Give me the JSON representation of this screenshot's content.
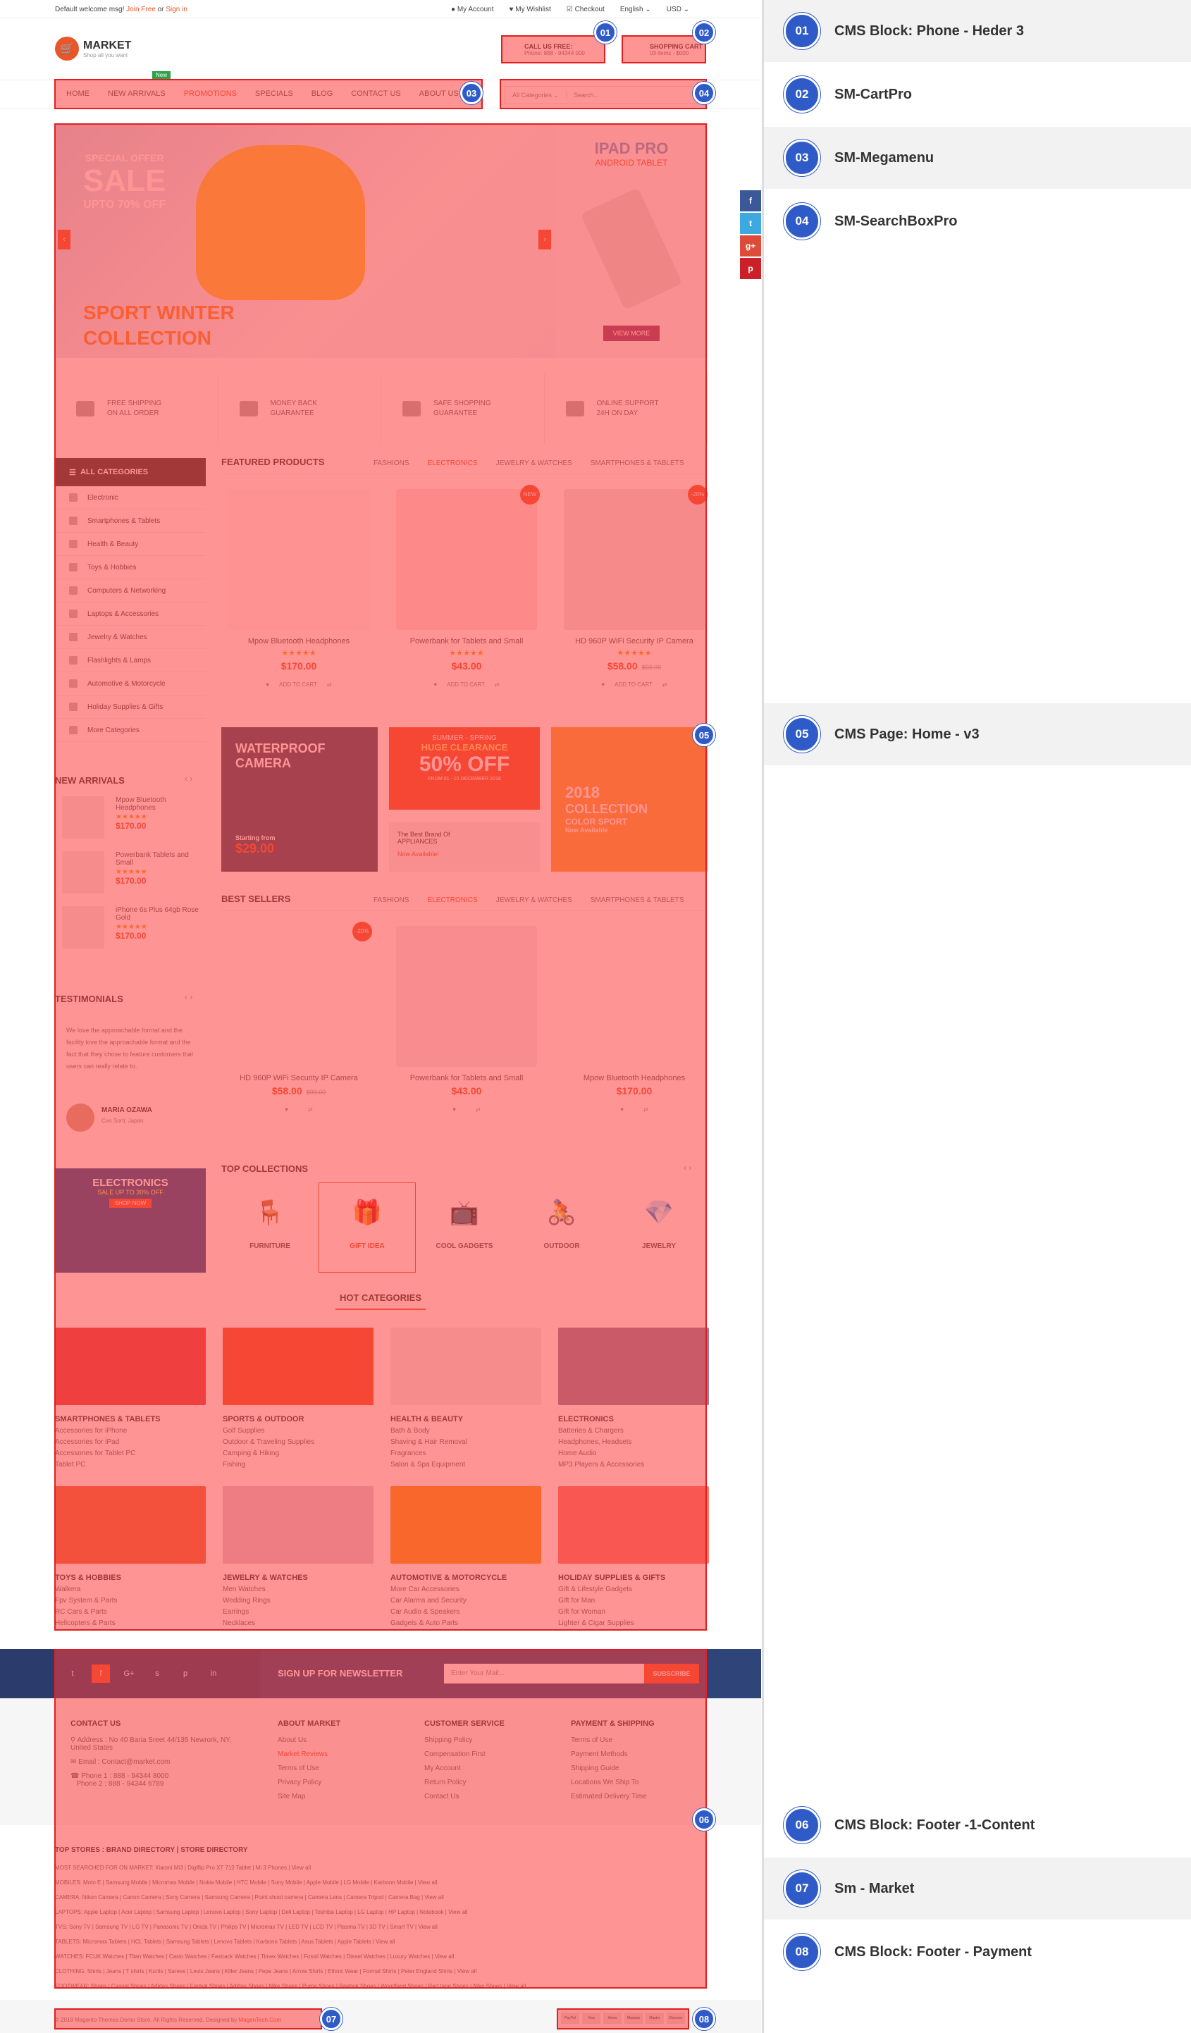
{
  "topbar": {
    "welcome": "Default welcome msg!",
    "join": "Join Free",
    "or": "or",
    "signin": "Sign in",
    "account": "My Account",
    "wishlist": "My Wishlist",
    "checkout": "Checkout",
    "language": "English",
    "currency": "USD"
  },
  "logo": {
    "name": "MARKET",
    "tagline": "Shop all you want"
  },
  "phone": {
    "title": "CALL US FREE:",
    "number": "Phone: 888 - 94344 000"
  },
  "cart": {
    "title": "SHOPPING CART",
    "items": "03 items - $000"
  },
  "nav": {
    "badge": "New",
    "items": [
      "HOME",
      "NEW ARRIVALS",
      "PROMOTIONS",
      "SPECIALS",
      "BLOG",
      "CONTACT US",
      "ABOUT US"
    ]
  },
  "search": {
    "category": "All Categories",
    "placeholder": "Search..."
  },
  "slider": {
    "special": "SPECIAL OFFER",
    "sale": "SALE",
    "upto": "UPTO 70% OFF",
    "coll1": "SPORT WINTER",
    "coll2": "COLLECTION",
    "side_title": "IPAD PRO",
    "side_sub": "ANDROID TABLET",
    "view_more": "VIEW MORE"
  },
  "services": [
    {
      "l1": "FREE SHIPPING",
      "l2": "ON ALL ORDER"
    },
    {
      "l1": "MONEY BACK",
      "l2": "GUARANTEE"
    },
    {
      "l1": "SAFE SHOPPING",
      "l2": "GUARANTEE"
    },
    {
      "l1": "ONLINE SUPPORT",
      "l2": "24H ON DAY"
    }
  ],
  "categories": {
    "title": "ALL CATEGORIES",
    "items": [
      "Electronic",
      "Smartphones & Tablets",
      "Health & Beauty",
      "Toys & Hobbies",
      "Computers & Networking",
      "Laptops & Accessories",
      "Jewelry & Watches",
      "Flashlights & Lamps",
      "Automotive & Motorcycle",
      "Holiday Supplies & Gifts",
      "More Categories"
    ]
  },
  "featured": {
    "title": "FEATURED PRODUCTS",
    "tabs": [
      "FASHIONS",
      "ELECTRONICS",
      "JEWELRY & WATCHES",
      "SMARTPHONES & TABLETS"
    ],
    "products": [
      {
        "name": "Mpow Bluetooth Headphones",
        "price": "$170.00",
        "old": "",
        "badge": ""
      },
      {
        "name": "Powerbank for Tablets and Small",
        "price": "$43.00",
        "old": "",
        "badge": "NEW"
      },
      {
        "name": "HD 960P WiFi Security IP Camera",
        "price": "$58.00",
        "old": "$93.00",
        "badge": "-20%"
      }
    ],
    "add": "ADD TO CART",
    "stars": "★★★★★"
  },
  "new_arrivals": {
    "title": "NEW ARRIVALS",
    "items": [
      {
        "name": "Mpow Bluetooth Headphones",
        "price": "$170.00"
      },
      {
        "name": "Powerbank Tablets and Small",
        "price": "$170.00"
      },
      {
        "name": "iPhone 6s Plus 64gb Rose Gold",
        "price": "$170.00"
      }
    ]
  },
  "banners": {
    "b1": "WATERPROOF CAMERA",
    "b1s": "Starting from",
    "b1p": "$29.00",
    "b2a": "SUMMER - SPRING",
    "b2b": "HUGE CLEARANCE",
    "b2c": "50% OFF",
    "b2d": "FROM 01 - 15 DECEMBER 2018",
    "b3": "The Best Brand Of APPLIANCES",
    "b3s": "Now Available!",
    "b4": "2018",
    "b4b": "COLLECTION",
    "b4c": "COLOR SPORT",
    "b4d": "Now Available"
  },
  "testimonials": {
    "title": "TESTIMONIALS",
    "text": "We love the approachable format and the facility love the approachable format and the fact that they chose to feature customers that users can really relate to.",
    "name": "MARIA OZAWA",
    "role": "Ceo Sorti, Japan"
  },
  "best": {
    "title": "BEST SELLERS",
    "tabs": [
      "FASHIONS",
      "ELECTRONICS",
      "JEWELRY & WATCHES",
      "SMARTPHONES & TABLETS"
    ],
    "products": [
      {
        "name": "HD 960P WiFi Security IP Camera",
        "price": "$58.00",
        "old": "$93.00",
        "badge": "-20%"
      },
      {
        "name": "Powerbank for Tablets and Small",
        "price": "$43.00",
        "old": "",
        "badge": ""
      },
      {
        "name": "Mpow Bluetooth Headphones",
        "price": "$170.00",
        "old": "",
        "badge": ""
      }
    ]
  },
  "promo": {
    "title": "ELECTRONICS",
    "sub": "SALE UP TO 30% OFF",
    "btn": "SHOP NOW"
  },
  "collections": {
    "title": "TOP COLLECTIONS",
    "items": [
      "FURNITURE",
      "GIFT IDEA",
      "COOL GADGETS",
      "OUTDOOR",
      "JEWELRY"
    ]
  },
  "hot": {
    "title": "HOT CATEGORIES",
    "cats": [
      {
        "t": "SMARTPHONES & TABLETS",
        "l": [
          "Accessories for iPhone",
          "Accessories for iPad",
          "Accessories for Tablet PC",
          "Tablet PC"
        ]
      },
      {
        "t": "SPORTS & OUTDOOR",
        "l": [
          "Golf Supplies",
          "Outdoor & Traveling Supplies",
          "Camping & Hiking",
          "Fishing"
        ]
      },
      {
        "t": "HEALTH & BEAUTY",
        "l": [
          "Bath & Body",
          "Shaving & Hair Removal",
          "Fragrances",
          "Salon & Spa Equipment"
        ]
      },
      {
        "t": "ELECTRONICS",
        "l": [
          "Batteries & Chargers",
          "Headphones, Headsets",
          "Home Audio",
          "MP3 Players & Accessories"
        ]
      },
      {
        "t": "TOYS & HOBBIES",
        "l": [
          "Walkera",
          "Fpv System & Parts",
          "RC Cars & Parts",
          "Helicopters & Parts"
        ]
      },
      {
        "t": "JEWELRY & WATCHES",
        "l": [
          "Men Watches",
          "Wedding Rings",
          "Earrings",
          "Necklaces"
        ]
      },
      {
        "t": "AUTOMOTIVE & MOTORCYCLE",
        "l": [
          "More Car Accessories",
          "Car Alarms and Security",
          "Car Audio & Speakers",
          "Gadgets & Auto Parts"
        ]
      },
      {
        "t": "HOLIDAY SUPPLIES & GIFTS",
        "l": [
          "Gift & Lifestyle Gadgets",
          "Gift for Man",
          "Gift for Woman",
          "Lighter & Cigar Supplies"
        ]
      }
    ]
  },
  "newsletter": {
    "title": "SIGN UP FOR NEWSLETTER",
    "placeholder": "Enter Your Mail...",
    "btn": "SUBSCRIBE"
  },
  "footer": {
    "contact_title": "CONTACT US",
    "address": "Address : No 40 Baria Sreet 44/135 Newrork, NY, United States",
    "email": "Email : Contact@market.com",
    "phone1": "Phone 1 : 888 - 94344 8000",
    "phone2": "Phone 2 : 888 - 94344 6789",
    "cols": [
      {
        "t": "ABOUT MARKET",
        "l": [
          "About Us",
          "Market Reviews",
          "Terms of Use",
          "Privacy Policy",
          "Site Map"
        ]
      },
      {
        "t": "CUSTOMER SERVICE",
        "l": [
          "Shipping Policy",
          "Compensation First",
          "My Account",
          "Return Policy",
          "Contact Us"
        ]
      },
      {
        "t": "PAYMENT & SHIPPING",
        "l": [
          "Terms of Use",
          "Payment Methods",
          "Shipping Guide",
          "Locations We Ship To",
          "Estimated Delivery Time"
        ]
      }
    ],
    "stores_title": "TOP STORES : BRAND DIRECTORY | STORE DIRECTORY",
    "stores": [
      "MOST SEARCHED FOR ON MARKET: Xiaomi Mi3 | Digiflip Pro XT 712 Tablet | Mi 3 Phones | View all",
      "MOBILES: Moto E | Samsung Mobile | Micromax Mobile | Nokia Mobile | HTC Mobile | Sony Mobile | Apple Mobile | LG Mobile | Karbonn Mobile | View all",
      "CAMERA: Nikon Camera | Canon Camera | Sony Camera | Samsung Camera | Point shoot camera | Camera Lens | Camera Tripod | Camera Bag | View all",
      "LAPTOPS: Apple Laptop | Acer Laptop | Samsung Laptop | Lenovo Laptop | Sony Laptop | Dell Laptop | Toshiba Laptop | LG Laptop | HP Laptop | Notebook | View all",
      "TVS: Sony TV | Samsung TV | LG TV | Panasonic TV | Onida TV | Philips TV | Micromax TV | LED TV | LCD TV | Plasma TV | 3D TV | Smart TV | View all",
      "TABLETS: Micromax Tablets | HCL Tablets | Samsung Tablets | Lenovo Tablets | Karbonn Tablets | Asus Tablets | Apple Tablets | View all",
      "WATCHES: FCUK Watches | Titan Watches | Casio Watches | Fastrack Watches | Timex Watches | Fossil Watches | Diesel Watches | Luxury Watches | View all",
      "CLOTHING: Shirts | Jeans | T shirts | Kurtis | Sarees | Levis Jeans | Killer Jeans | Pepe Jeans | Arrow Shirts | Ethnic Wear | Formal Shirts | Peter England Shirts | View all",
      "FOOTWEAR: Shoes | Casual Shoes | Adidas Shoes | Formal Shoes | Adidas Shoes | Nike Shoes | Puma Shoes | Reebok Shoes | Woodland Shoes | Red tape Shoes | Nike Shoes | View all"
    ],
    "copyright": "© 2018 Magento Themes Demo Store. All Rights Reserved. Designed by",
    "designer": "MagenTech.Com",
    "payments": [
      "PayPal",
      "Visa",
      "Amex",
      "Maestro",
      "Master",
      "Discover"
    ]
  },
  "social_bar": [
    "f",
    "t",
    "g+",
    "p"
  ],
  "legend": [
    {
      "n": "01",
      "t": "CMS Block: Phone - Heder 3"
    },
    {
      "n": "02",
      "t": "SM-CartPro"
    },
    {
      "n": "03",
      "t": "SM-Megamenu"
    },
    {
      "n": "04",
      "t": "SM-SearchBoxPro"
    },
    {
      "n": "05",
      "t": "CMS Page: Home - v3"
    },
    {
      "n": "06",
      "t": "CMS Block: Footer -1-Content"
    },
    {
      "n": "07",
      "t": "Sm - Market"
    },
    {
      "n": "08",
      "t": "CMS Block: Footer - Payment"
    }
  ],
  "colors": {
    "accent": "#e8562a",
    "overlay": "#ff3c3c",
    "bubble": "#2f5bc9",
    "navy": "#2b3b6b"
  }
}
